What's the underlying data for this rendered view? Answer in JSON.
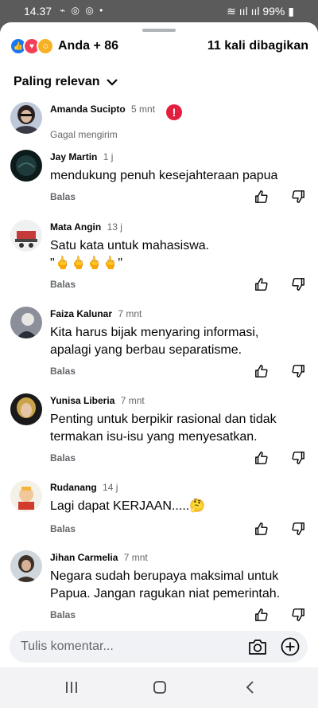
{
  "status": {
    "time": "14.37",
    "battery": "99%"
  },
  "header": {
    "reactions_label": "Anda + 86",
    "shares_label": "11 kali dibagikan"
  },
  "sort": {
    "label": "Paling relevan"
  },
  "comments": [
    {
      "name": "Amanda Sucipto",
      "time": "5 mnt",
      "status": "Gagal mengirim"
    },
    {
      "name": "Jay Martin",
      "time": "1 j",
      "text": "mendukung penuh kesejahteraan papua",
      "reply": "Balas"
    },
    {
      "name": "Mata Angin",
      "time": "13 j",
      "text": "Satu kata untuk mahasiswa.",
      "text2": "\"🖕🖕🖕🖕\"",
      "reply": "Balas"
    },
    {
      "name": "Faiza Kalunar",
      "time": "7 mnt",
      "text": "Kita harus bijak menyaring informasi, apalagi yang berbau separatisme.",
      "reply": "Balas"
    },
    {
      "name": "Yunisa Liberia",
      "time": "7 mnt",
      "text": "Penting untuk berpikir rasional dan tidak termakan isu-isu yang menyesatkan.",
      "reply": "Balas"
    },
    {
      "name": "Rudanang",
      "time": "14 j",
      "text": "Lagi dapat KERJAAN.....🤔",
      "reply": "Balas"
    },
    {
      "name": "Jihan Carmelia",
      "time": "7 mnt",
      "text": "Negara sudah berupaya maksimal untuk Papua. Jangan ragukan niat pemerintah.",
      "reply": "Balas"
    }
  ],
  "composer": {
    "placeholder": "Tulis komentar..."
  }
}
